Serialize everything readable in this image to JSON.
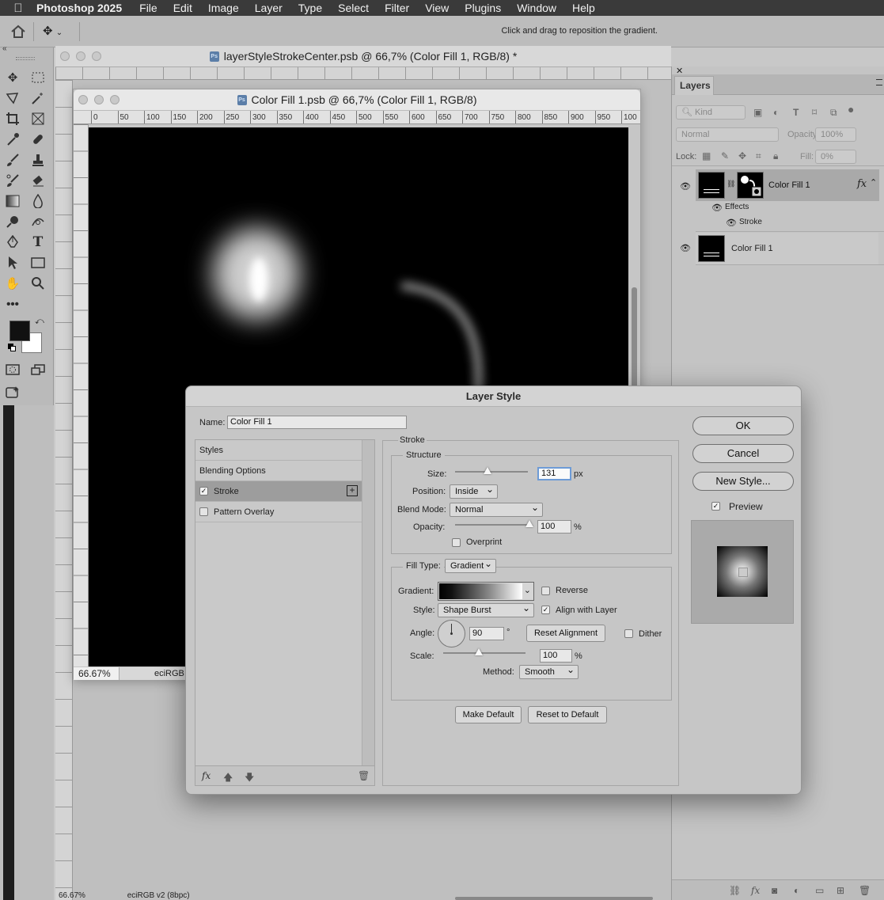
{
  "menubar": {
    "app_name": "Photoshop 2025",
    "items": [
      "File",
      "Edit",
      "Image",
      "Layer",
      "Type",
      "Select",
      "Filter",
      "View",
      "Plugins",
      "Window",
      "Help"
    ]
  },
  "options_bar": {
    "hint": "Click and drag to reposition the gradient."
  },
  "doc_back": {
    "title": "layerStyleStrokeCenter.psb @ 66,7% (Color Fill 1, RGB/8) *",
    "zoom": "66.67%",
    "profile": "eciRGB v2 (8bpc)"
  },
  "doc_front": {
    "title": "Color Fill 1.psb @ 66,7% (Color Fill 1, RGB/8)",
    "zoom": "66.67%",
    "profile": "eciRGB v",
    "ruler_ticks": [
      "0",
      "50",
      "100",
      "150",
      "200",
      "250",
      "300",
      "350",
      "400",
      "450",
      "500",
      "550",
      "600",
      "650",
      "700",
      "750",
      "800",
      "850",
      "900",
      "950",
      "100"
    ]
  },
  "layers_panel": {
    "tab": "Layers",
    "kind_placeholder": "Kind",
    "blend_mode": "Normal",
    "opacity_label": "Opacity:",
    "opacity_value": "100%",
    "lock_label": "Lock:",
    "fill_label": "Fill:",
    "fill_value": "0%",
    "layers": [
      {
        "name": "Color Fill 1",
        "effects_label": "Effects",
        "effect": "Stroke",
        "fx": "fx"
      },
      {
        "name": "Color Fill 1"
      }
    ]
  },
  "dialog": {
    "title": "Layer Style",
    "name_label": "Name:",
    "name_value": "Color Fill 1",
    "style_list": [
      "Styles",
      "Blending Options",
      "Stroke",
      "Pattern Overlay"
    ],
    "stroke_title": "Stroke",
    "structure_title": "Structure",
    "size_label": "Size:",
    "size_value": "131",
    "size_unit": "px",
    "size_fraction": 0.45,
    "position_label": "Position:",
    "position_value": "Inside",
    "blend_label": "Blend Mode:",
    "blend_value": "Normal",
    "opacity_label": "Opacity:",
    "opacity_value": "100",
    "opacity_unit": "%",
    "opacity_fraction": 1.0,
    "overprint_label": "Overprint",
    "filltype_label": "Fill Type:",
    "filltype_value": "Gradient",
    "gradient_label": "Gradient:",
    "reverse_label": "Reverse",
    "style_label": "Style:",
    "style_value": "Shape Burst",
    "align_label": "Align with Layer",
    "angle_label": "Angle:",
    "angle_value": "90",
    "angle_unit": "°",
    "reset_alignment": "Reset Alignment",
    "dither_label": "Dither",
    "scale_label": "Scale:",
    "scale_value": "100",
    "scale_unit": "%",
    "scale_fraction": 0.43,
    "method_label": "Method:",
    "method_value": "Smooth",
    "make_default": "Make Default",
    "reset_default": "Reset to Default",
    "ok": "OK",
    "cancel": "Cancel",
    "new_style": "New Style...",
    "preview_label": "Preview",
    "fx_label": "fx"
  }
}
